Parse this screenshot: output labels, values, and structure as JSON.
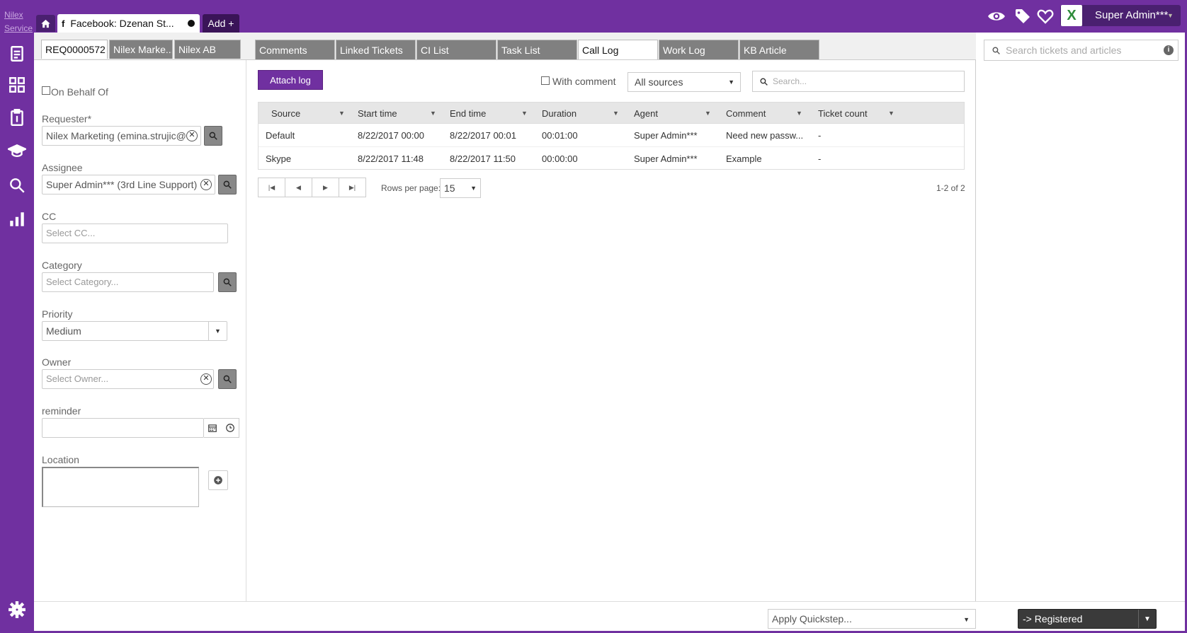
{
  "app": {
    "brand_line1": "Nilex",
    "brand_line2": "Service"
  },
  "header": {
    "home_icon": "home-icon",
    "open_tab_icon": "f",
    "open_tab_label": "Facebook: Dzenan St...",
    "add_tab_label": "Add +",
    "user_name": "Super Admin***",
    "logo_letter": "X",
    "colors": {
      "brand": "#7030a0",
      "dark": "#3a1458"
    }
  },
  "left": {
    "tabs": [
      "REQ0000572",
      "Nilex Marke...",
      "Nilex AB"
    ],
    "on_behalf_label": "On Behalf Of",
    "requester_label": "Requester*",
    "requester_value": "Nilex Marketing (emina.strujic@",
    "assignee_label": "Assignee",
    "assignee_value": "Super Admin*** (3rd Line Support)",
    "cc_label": "CC",
    "cc_placeholder": "Select CC...",
    "category_label": "Category",
    "category_placeholder": "Select Category...",
    "priority_label": "Priority",
    "priority_value": "Medium",
    "owner_label": "Owner",
    "owner_placeholder": "Select Owner...",
    "reminder_label": "reminder",
    "location_label": "Location"
  },
  "center": {
    "tabs": [
      "Comments",
      "Linked Tickets",
      "CI List",
      "Task List",
      "Call Log",
      "Work Log",
      "KB Article"
    ],
    "active_tab": "Call Log",
    "attach_label": "Attach log",
    "with_comment_label": "With comment",
    "source_filter": "All sources",
    "search_placeholder": "Search...",
    "columns": [
      "Source",
      "Start time",
      "End time",
      "Duration",
      "Agent",
      "Comment",
      "Ticket count"
    ],
    "rows": [
      {
        "source": "Default",
        "start": "8/22/2017 00:00",
        "end": "8/22/2017 00:01",
        "duration": "00:01:00",
        "agent": "Super Admin***",
        "comment": "Need new passw...",
        "count": "-"
      },
      {
        "source": "Skype",
        "start": "8/22/2017 11:48",
        "end": "8/22/2017 11:50",
        "duration": "00:00:00",
        "agent": "Super Admin***",
        "comment": "Example",
        "count": "-"
      }
    ],
    "rows_per_page_label": "Rows per page:",
    "rows_per_page_value": "15",
    "count_info": "1-2 of 2"
  },
  "right": {
    "search_placeholder": "Search tickets and articles"
  },
  "footer": {
    "quickstep_placeholder": "Apply Quickstep...",
    "status_label": "-> Registered"
  }
}
